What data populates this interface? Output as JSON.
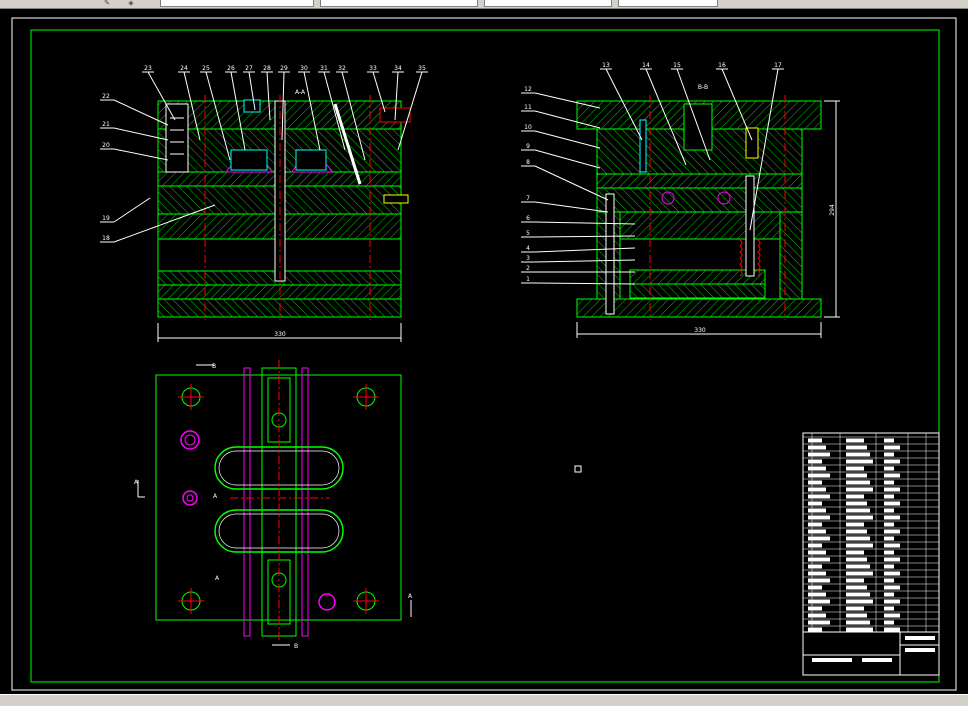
{
  "toolbar": {
    "fields": [
      "",
      "",
      "",
      "",
      ""
    ]
  },
  "drawing": {
    "section_labels": [
      "A-A",
      "B-B"
    ],
    "dim_left_width": "330",
    "dim_right_width": "330",
    "dim_right_height": "294",
    "balloons_left": [
      "23",
      "24",
      "25",
      "26",
      "27",
      "28",
      "29",
      "30",
      "31",
      "32",
      "33",
      "34",
      "35"
    ],
    "balloons_left_side": [
      "22",
      "21",
      "20",
      "19",
      "18"
    ],
    "balloons_right_top": [
      "13",
      "14",
      "15",
      "16",
      "17"
    ],
    "balloons_right_side": [
      "12",
      "11",
      "10",
      "9",
      "8",
      "7",
      "6",
      "5",
      "4",
      "3",
      "2",
      "1"
    ],
    "view_marks": [
      "B",
      "B",
      "A",
      "A",
      "A",
      "A"
    ]
  },
  "colors": {
    "frame": "#00ff00",
    "hatch": "#00ff00",
    "white": "#ffffff",
    "magenta": "#ff00ff",
    "red": "#ff0000",
    "yellow": "#ffff00",
    "cyan": "#00ffff"
  }
}
